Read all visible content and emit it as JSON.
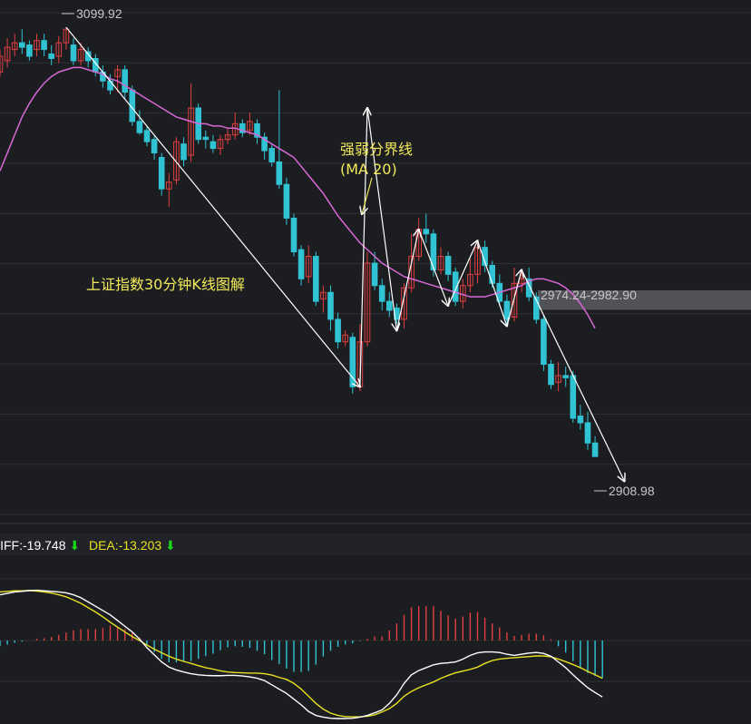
{
  "chart_data": {
    "type": "candlestick",
    "title": "上证指数30分钟K线图解",
    "annotation": {
      "line1": "强弱分界线",
      "line2": "(MA 20)"
    },
    "price_labels": {
      "high": "3099.92",
      "low": "2908.98",
      "zone": "2974.24-2982.90"
    },
    "zone": [
      2974.24,
      2982.9
    ],
    "ylim": [
      2880,
      3110
    ],
    "colors": {
      "up": "#e0403f",
      "down": "#31c3d4",
      "ma": "#d768d6",
      "dif": "#ffffff",
      "dea": "#e8e020",
      "wave": "#ffffff",
      "zone": "#5a5c61"
    },
    "candles": [
      [
        3080,
        3087,
        3090,
        3078
      ],
      [
        3085,
        3091,
        3095,
        3082
      ],
      [
        3090,
        3093,
        3097,
        3087
      ],
      [
        3093,
        3091,
        3099,
        3088
      ],
      [
        3092,
        3087,
        3094,
        3085
      ],
      [
        3090,
        3094,
        3097,
        3087
      ],
      [
        3094,
        3090,
        3097,
        3087
      ],
      [
        3088,
        3086,
        3092,
        3083
      ],
      [
        3087,
        3093,
        3096,
        3084
      ],
      [
        3093,
        3099,
        3099.92,
        3090
      ],
      [
        3092,
        3085,
        3095,
        3083
      ],
      [
        3085,
        3090,
        3093,
        3083
      ],
      [
        3089,
        3085,
        3091,
        3082
      ],
      [
        3086,
        3080,
        3088,
        3078
      ],
      [
        3080,
        3076,
        3083,
        3073
      ],
      [
        3076,
        3072,
        3079,
        3070
      ],
      [
        3078,
        3081,
        3083,
        3071
      ],
      [
        3081,
        3071,
        3083,
        3068
      ],
      [
        3072,
        3058,
        3074,
        3056
      ],
      [
        3058,
        3053,
        3063,
        3052
      ],
      [
        3054,
        3049,
        3056,
        3047
      ],
      [
        3050,
        3044,
        3052,
        3041
      ],
      [
        3042,
        3028,
        3044,
        3025
      ],
      [
        3028,
        3031,
        3035,
        3020
      ],
      [
        3032,
        3049,
        3051,
        3030
      ],
      [
        3048,
        3041,
        3051,
        3038
      ],
      [
        3043,
        3064,
        3075,
        3040
      ],
      [
        3064,
        3050,
        3066,
        3048
      ],
      [
        3051,
        3050,
        3054,
        3046
      ],
      [
        3049,
        3046,
        3052,
        3044
      ],
      [
        3046,
        3050,
        3052,
        3043
      ],
      [
        3050,
        3052,
        3055,
        3048
      ],
      [
        3052,
        3057,
        3062,
        3050
      ],
      [
        3057,
        3053,
        3059,
        3051
      ],
      [
        3054,
        3058,
        3062,
        3052
      ],
      [
        3057,
        3051,
        3059,
        3048
      ],
      [
        3051,
        3045,
        3053,
        3041
      ],
      [
        3046,
        3040,
        3048,
        3038
      ],
      [
        3040,
        3030,
        3072,
        3028
      ],
      [
        3030,
        3015,
        3033,
        3012
      ],
      [
        3015,
        3000,
        3017,
        2998
      ],
      [
        3001,
        2988,
        3003,
        2985
      ],
      [
        2989,
        2998,
        3003,
        2986
      ],
      [
        2998,
        2978,
        3000,
        2976
      ],
      [
        2979,
        2982,
        2985,
        2973
      ],
      [
        2982,
        2970,
        2985,
        2965
      ],
      [
        2970,
        2960,
        2973,
        2957
      ],
      [
        2960,
        2963,
        2965,
        2958
      ],
      [
        2962,
        2940,
        2964,
        2937
      ],
      [
        2940,
        2960,
        2968,
        2938
      ],
      [
        2960,
        2995,
        3000,
        2958
      ],
      [
        2995,
        2985,
        3000,
        2983
      ],
      [
        2985,
        2978,
        2988,
        2974
      ],
      [
        2978,
        2974,
        2982,
        2971
      ],
      [
        2975,
        2970,
        2977,
        2968
      ],
      [
        2970,
        2984,
        2986,
        2966
      ],
      [
        2984,
        2998,
        3008,
        2982
      ],
      [
        2998,
        3010,
        3015,
        2996
      ],
      [
        3010,
        3008,
        3017,
        3004
      ],
      [
        3008,
        2992,
        3010,
        2989
      ],
      [
        2992,
        2998,
        3002,
        2990
      ],
      [
        2998,
        2990,
        3000,
        2987
      ],
      [
        2991,
        2978,
        2993,
        2976
      ],
      [
        2978,
        2985,
        2988,
        2975
      ],
      [
        2985,
        2990,
        2997,
        2982
      ],
      [
        2990,
        3002,
        3005,
        2986
      ],
      [
        3002,
        2994,
        3005,
        2991
      ],
      [
        2994,
        2986,
        2996,
        2984
      ],
      [
        2986,
        2978,
        2990,
        2976
      ],
      [
        2978,
        2970,
        2981,
        2967
      ],
      [
        2971,
        2986,
        2993,
        2969
      ],
      [
        2986,
        2988,
        2991,
        2982
      ],
      [
        2988,
        2980,
        2993,
        2978
      ],
      [
        2980,
        2970,
        2982,
        2968
      ],
      [
        2970,
        2950,
        2972,
        2947
      ],
      [
        2950,
        2941,
        2952,
        2939
      ],
      [
        2942,
        2945,
        2951,
        2938
      ],
      [
        2945,
        2944,
        2949,
        2940
      ],
      [
        2945,
        2926,
        2947,
        2924
      ],
      [
        2927,
        2924,
        2932,
        2921
      ],
      [
        2924,
        2915,
        2929,
        2912
      ],
      [
        2915,
        2908.98,
        2918,
        2908.98
      ]
    ],
    "ma20": [
      3036,
      3044,
      3052,
      3060,
      3066,
      3071,
      3075,
      3078,
      3080,
      3081,
      3082,
      3082,
      3081,
      3080,
      3079,
      3077,
      3076,
      3074,
      3072,
      3070,
      3068,
      3066,
      3064,
      3062,
      3060,
      3059,
      3058,
      3057,
      3057,
      3056,
      3056,
      3055,
      3055,
      3054,
      3053,
      3052,
      3050,
      3048,
      3046,
      3044,
      3042,
      3038,
      3034,
      3030,
      3026,
      3021,
      3016,
      3012,
      3008,
      3004,
      3001,
      2998,
      2995,
      2993,
      2991,
      2989,
      2988,
      2987,
      2986,
      2985,
      2984,
      2983,
      2982,
      2981,
      2980,
      2980,
      2980,
      2981,
      2982,
      2983,
      2984,
      2985,
      2987,
      2988,
      2988,
      2987,
      2986,
      2984,
      2981,
      2977,
      2972,
      2966
    ],
    "dif": [
      16,
      16.5,
      17,
      17.2,
      17.5,
      17.6,
      17.4,
      17.2,
      17,
      16.7,
      16,
      15,
      13.5,
      12,
      10.5,
      9,
      7,
      5,
      3,
      0.5,
      -2.5,
      -5,
      -7.5,
      -9.3,
      -10.3,
      -11,
      -11.6,
      -12,
      -12.2,
      -12.3,
      -12.3,
      -12.2,
      -12.2,
      -12.4,
      -12.7,
      -13.2,
      -14,
      -15.5,
      -17,
      -18.5,
      -20.5,
      -22.5,
      -24.8,
      -26.2,
      -26.8,
      -27.2,
      -27.3,
      -27.3,
      -27.2,
      -26.8,
      -26.2,
      -25.3,
      -24.3,
      -22,
      -19,
      -15,
      -12,
      -10.5,
      -9.5,
      -8.5,
      -8,
      -7.8,
      -7.5,
      -6.5,
      -5.2,
      -4.3,
      -4,
      -4,
      -4.2,
      -4.8,
      -5.2,
      -4.8,
      -4.4,
      -4.2,
      -4.5,
      -5.5,
      -7.5,
      -9.5,
      -12,
      -14.3,
      -16.5,
      -18.2,
      -19.748
    ],
    "dea": [
      17,
      17.2,
      17.4,
      17.4,
      17.5,
      17.3,
      17,
      16.6,
      16,
      15.3,
      14.2,
      13,
      11.5,
      10,
      8.3,
      6.4,
      4.7,
      3,
      1.4,
      0,
      -1.6,
      -3,
      -4.3,
      -5.5,
      -6.5,
      -7.3,
      -8,
      -8.8,
      -9.5,
      -10,
      -10.6,
      -11,
      -11.2,
      -11.3,
      -11.4,
      -11.4,
      -11.6,
      -12.1,
      -12.9,
      -13.6,
      -15,
      -17,
      -19.5,
      -22,
      -24,
      -25.4,
      -26.2,
      -26.6,
      -26.7,
      -26.7,
      -26.5,
      -26,
      -25,
      -23.8,
      -22,
      -19.5,
      -17.8,
      -16.5,
      -15.5,
      -14.5,
      -13.2,
      -12.2,
      -11.3,
      -10.7,
      -10.1,
      -9.3,
      -8,
      -7,
      -6.5,
      -6.2,
      -6,
      -5.8,
      -5.6,
      -5.4,
      -5.4,
      -5.7,
      -6.5,
      -7.4,
      -8.4,
      -9.5,
      -10.8,
      -12,
      -13.203
    ],
    "macd_values": {
      "dif": "-19.748",
      "dea": "-13.203"
    },
    "macd_labels": {
      "dif": "DIFF:",
      "dea": "DEA:"
    }
  }
}
